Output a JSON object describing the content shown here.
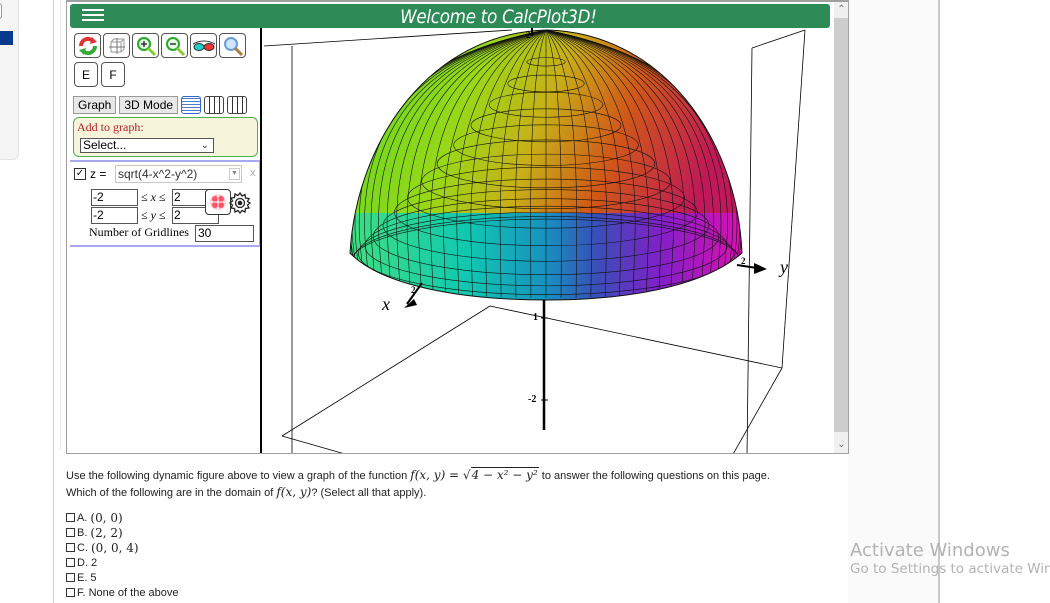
{
  "app": {
    "title": "Welcome to CalcPlot3D!",
    "accent_color": "#2e8b57",
    "toolbar_icons": [
      "reset-view-icon",
      "box-toggle-icon",
      "zoom-in-icon",
      "zoom-out-icon",
      "3d-glasses-icon",
      "magnifier-icon"
    ],
    "e_button": "E",
    "f_button": "F",
    "graph_tab": "Graph",
    "mode_tab": "3D Mode",
    "add_to_graph_label": "Add to graph:",
    "add_select_value": "Select...",
    "function": {
      "checked": true,
      "check_glyph": "✓",
      "z_label": "z =",
      "expression": "sqrt(4-x^2-y^2)",
      "remove_label": "x",
      "x_min": "-2",
      "x_max": "2",
      "x_range_label": "≤ x ≤",
      "y_min": "-2",
      "y_max": "2",
      "y_range_label": "≤ y ≤",
      "gridlines_label": "Number of Gridlines",
      "gridlines_value": "30"
    },
    "plot": {
      "surface": "hemisphere",
      "x_axis_label": "x",
      "y_axis_label": "y",
      "x_tick": "2",
      "y_tick": "2",
      "z_top_tick": "2",
      "z_tick_1": "1",
      "z_tick_2": "-2"
    },
    "scroll_up": "^",
    "scroll_down": "v"
  },
  "question": {
    "line1_prefix": "Use the following dynamic figure above to view a graph of the function ",
    "func_lhs": "f(x, y) = √",
    "func_radicand": "4 − x² − y²",
    "line1_suffix": " to answer the following questions on this page.",
    "line2_prefix": "Which of the following are in the domain of ",
    "line2_func": "f(x, y)",
    "line2_suffix": "? (Select all that apply)."
  },
  "options": [
    {
      "letter": "A.",
      "value": "(0, 0)",
      "math": true
    },
    {
      "letter": "B.",
      "value": "(2, 2)",
      "math": true
    },
    {
      "letter": "C.",
      "value": "(0, 0, 4)",
      "math": true
    },
    {
      "letter": "D.",
      "value": "2",
      "math": false
    },
    {
      "letter": "E.",
      "value": "5",
      "math": false
    },
    {
      "letter": "F.",
      "value": "None of the above",
      "math": false
    }
  ],
  "watermark": {
    "line1": "Activate Windows",
    "line2": "Go to Settings to activate Windows."
  }
}
